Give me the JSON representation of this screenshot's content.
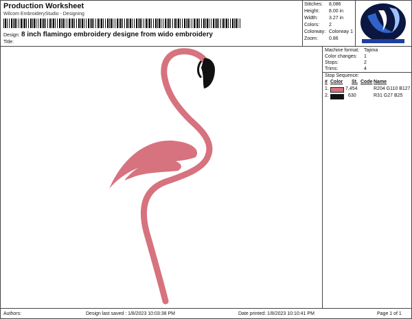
{
  "header": {
    "title": "Production Worksheet",
    "subtitle": "Wilcom EmbroideryStudio - Designing",
    "design_label": "Design:",
    "design_value": "8 inch flamingo embroidery designe from wido embroidery",
    "title_label": "Title:",
    "title_value": ""
  },
  "stats": [
    {
      "label": "Stitches:",
      "value": "8,086"
    },
    {
      "label": "Height:",
      "value": "8.00 in"
    },
    {
      "label": "Width:",
      "value": "3.27 in"
    },
    {
      "label": "Colors:",
      "value": "2"
    },
    {
      "label": "Colorway:",
      "value": "Colorway 1"
    },
    {
      "label": "Zoom:",
      "value": "0.86"
    }
  ],
  "machine": [
    {
      "label": "Machine format:",
      "value": "Tajima"
    },
    {
      "label": "Color changes:",
      "value": "1"
    },
    {
      "label": "Stops:",
      "value": "2"
    },
    {
      "label": "Trims:",
      "value": "4"
    }
  ],
  "stop_sequence": {
    "title": "Stop Sequence:",
    "headers": {
      "num": "#",
      "color": "Color",
      "st": "St.",
      "code": "Code",
      "name": "Name"
    },
    "rows": [
      {
        "num": "1.",
        "swatch": "#d7727f",
        "st": "7,454",
        "code": "",
        "name": "R204 G110 B127"
      },
      {
        "num": "2.",
        "swatch": "#111111",
        "st": "630",
        "code": "",
        "name": "R31 G27 B25"
      }
    ]
  },
  "footer": {
    "authors": "Authors:",
    "saved": "Design last saved : 1/8/2023 10:03:38 PM",
    "printed": "Date printed: 1/8/2023 10:10:41 PM",
    "page": "Page 1 of 1"
  },
  "colors": {
    "flamingo": "#d7727f",
    "beak": "#111111",
    "logo_blue": "#1f3f9e",
    "logo_dark": "#0b1740"
  }
}
